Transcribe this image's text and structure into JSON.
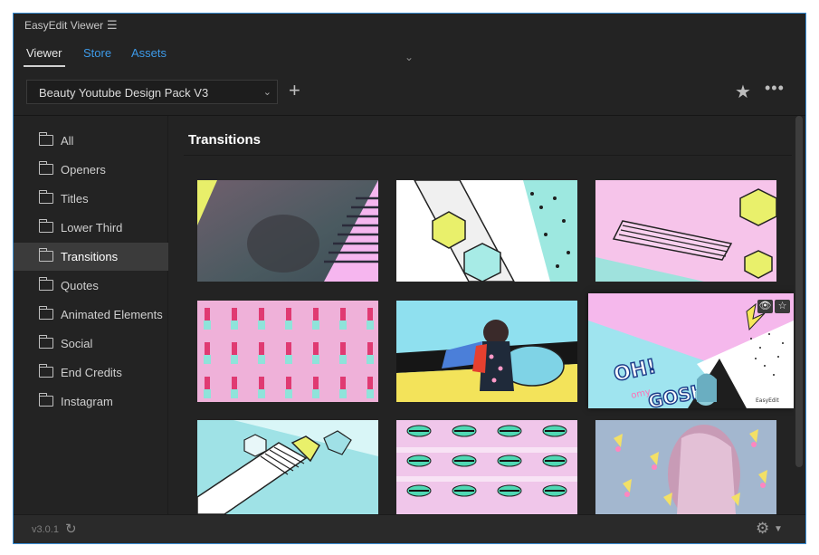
{
  "app": {
    "title": "EasyEdit Viewer",
    "menu_icon": "hamburger-menu-icon"
  },
  "tabs": [
    {
      "label": "Viewer",
      "active": true
    },
    {
      "label": "Store",
      "active": false
    },
    {
      "label": "Assets",
      "active": false
    }
  ],
  "toolbar": {
    "pack_selected": "Beauty Youtube Design Pack V3",
    "add_label": "+",
    "favorite_icon": "star-icon",
    "more_icon": "more-options-icon"
  },
  "sidebar": {
    "items": [
      {
        "label": "All",
        "selected": false
      },
      {
        "label": "Openers",
        "selected": false
      },
      {
        "label": "Titles",
        "selected": false
      },
      {
        "label": "Lower Third",
        "selected": false
      },
      {
        "label": "Transitions",
        "selected": true
      },
      {
        "label": "Quotes",
        "selected": false
      },
      {
        "label": "Animated Elements",
        "selected": false
      },
      {
        "label": "Social",
        "selected": false
      },
      {
        "label": "End Credits",
        "selected": false
      },
      {
        "label": "Instagram",
        "selected": false
      }
    ]
  },
  "main": {
    "section_title": "Transitions",
    "thumbnails": [
      {
        "name": "transition-1"
      },
      {
        "name": "transition-2"
      },
      {
        "name": "transition-3"
      },
      {
        "name": "transition-4"
      },
      {
        "name": "transition-5"
      },
      {
        "name": "transition-6",
        "hovered": true,
        "text": "OH! omy GOSH",
        "watermark": "EasyEdit"
      },
      {
        "name": "transition-7"
      },
      {
        "name": "transition-8"
      },
      {
        "name": "transition-9"
      }
    ]
  },
  "footer": {
    "version": "v3.0.1"
  },
  "colors": {
    "accent": "#3d9ae8",
    "selected_bg": "#3b3b3b",
    "panel_bg": "#232323"
  }
}
